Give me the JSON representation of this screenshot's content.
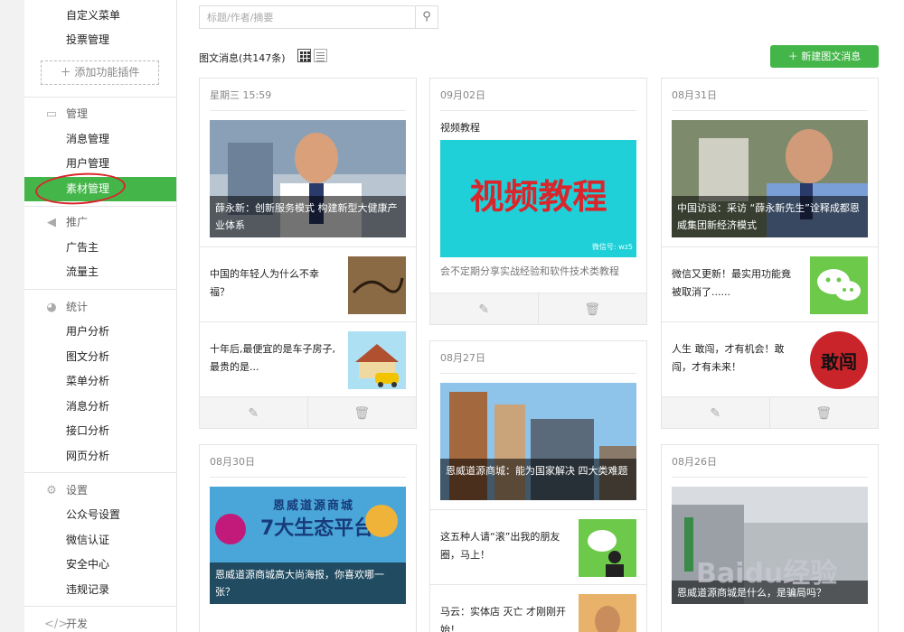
{
  "sidebar": {
    "top_items": [
      "自定义菜单",
      "投票管理"
    ],
    "add_plugin": "添加功能插件",
    "groups": [
      {
        "icon": "inbox-icon",
        "label": "管理",
        "items": [
          "消息管理",
          "用户管理",
          "素材管理"
        ]
      },
      {
        "icon": "megaphone-icon",
        "label": "推广",
        "items": [
          "广告主",
          "流量主"
        ]
      },
      {
        "icon": "pie-chart-icon",
        "label": "统计",
        "items": [
          "用户分析",
          "图文分析",
          "菜单分析",
          "消息分析",
          "接口分析",
          "网页分析"
        ]
      },
      {
        "icon": "gear-icon",
        "label": "设置",
        "items": [
          "公众号设置",
          "微信认证",
          "安全中心",
          "违规记录"
        ]
      },
      {
        "icon": "code-icon",
        "label": "开发",
        "items": []
      }
    ],
    "active_item": "素材管理"
  },
  "search": {
    "placeholder": "标题/作者/摘要"
  },
  "toolbar": {
    "count_label": "图文消息(共147条)",
    "new_button": "新建图文消息"
  },
  "cards": {
    "c1": {
      "date": "星期三 15:59",
      "cover_caption": "薛永新：创新服务模式 构建新型大健康产业体系",
      "subs": [
        "中国的年轻人为什么不幸福？",
        "十年后,最便宜的是车子房子,最贵的是..."
      ]
    },
    "c2": {
      "date": "09月02日",
      "title": "视频教程",
      "cover_text": "视频教程",
      "cover_watermark": "微信号: wz5",
      "desc": "会不定期分享实战经验和软件技术类教程"
    },
    "c3": {
      "date": "08月31日",
      "cover_caption": "中国访谈：采访 “薛永新先生”诠释成都恩威集团新经济模式",
      "subs": [
        "微信又更新！最实用功能竟被取消了......",
        "人生 敢闯，才有机会！敢闯，才有未来！"
      ],
      "sub2_thumb_text": "敢闯"
    },
    "c4": {
      "date": "08月30日",
      "cover_title": "恩威道源商城",
      "cover_big": "7大生态平台",
      "cover_caption": "恩威道源商城高大尚海报，你喜欢哪一张？"
    },
    "c5": {
      "date": "08月27日",
      "cover_caption": "恩威道源商城：能为国家解决 四大类难题",
      "subs": [
        "这五种人请“滚”出我的朋友圈，马上！",
        "马云：实体店 灭亡 才刚刚开始！"
      ]
    },
    "c6": {
      "date": "08月26日",
      "cover_caption": "恩威道源商城是什么，是骗局吗？"
    }
  },
  "watermark": "Baidu经验",
  "colors": {
    "accent": "#44b549",
    "annotation": "#d8262c"
  }
}
